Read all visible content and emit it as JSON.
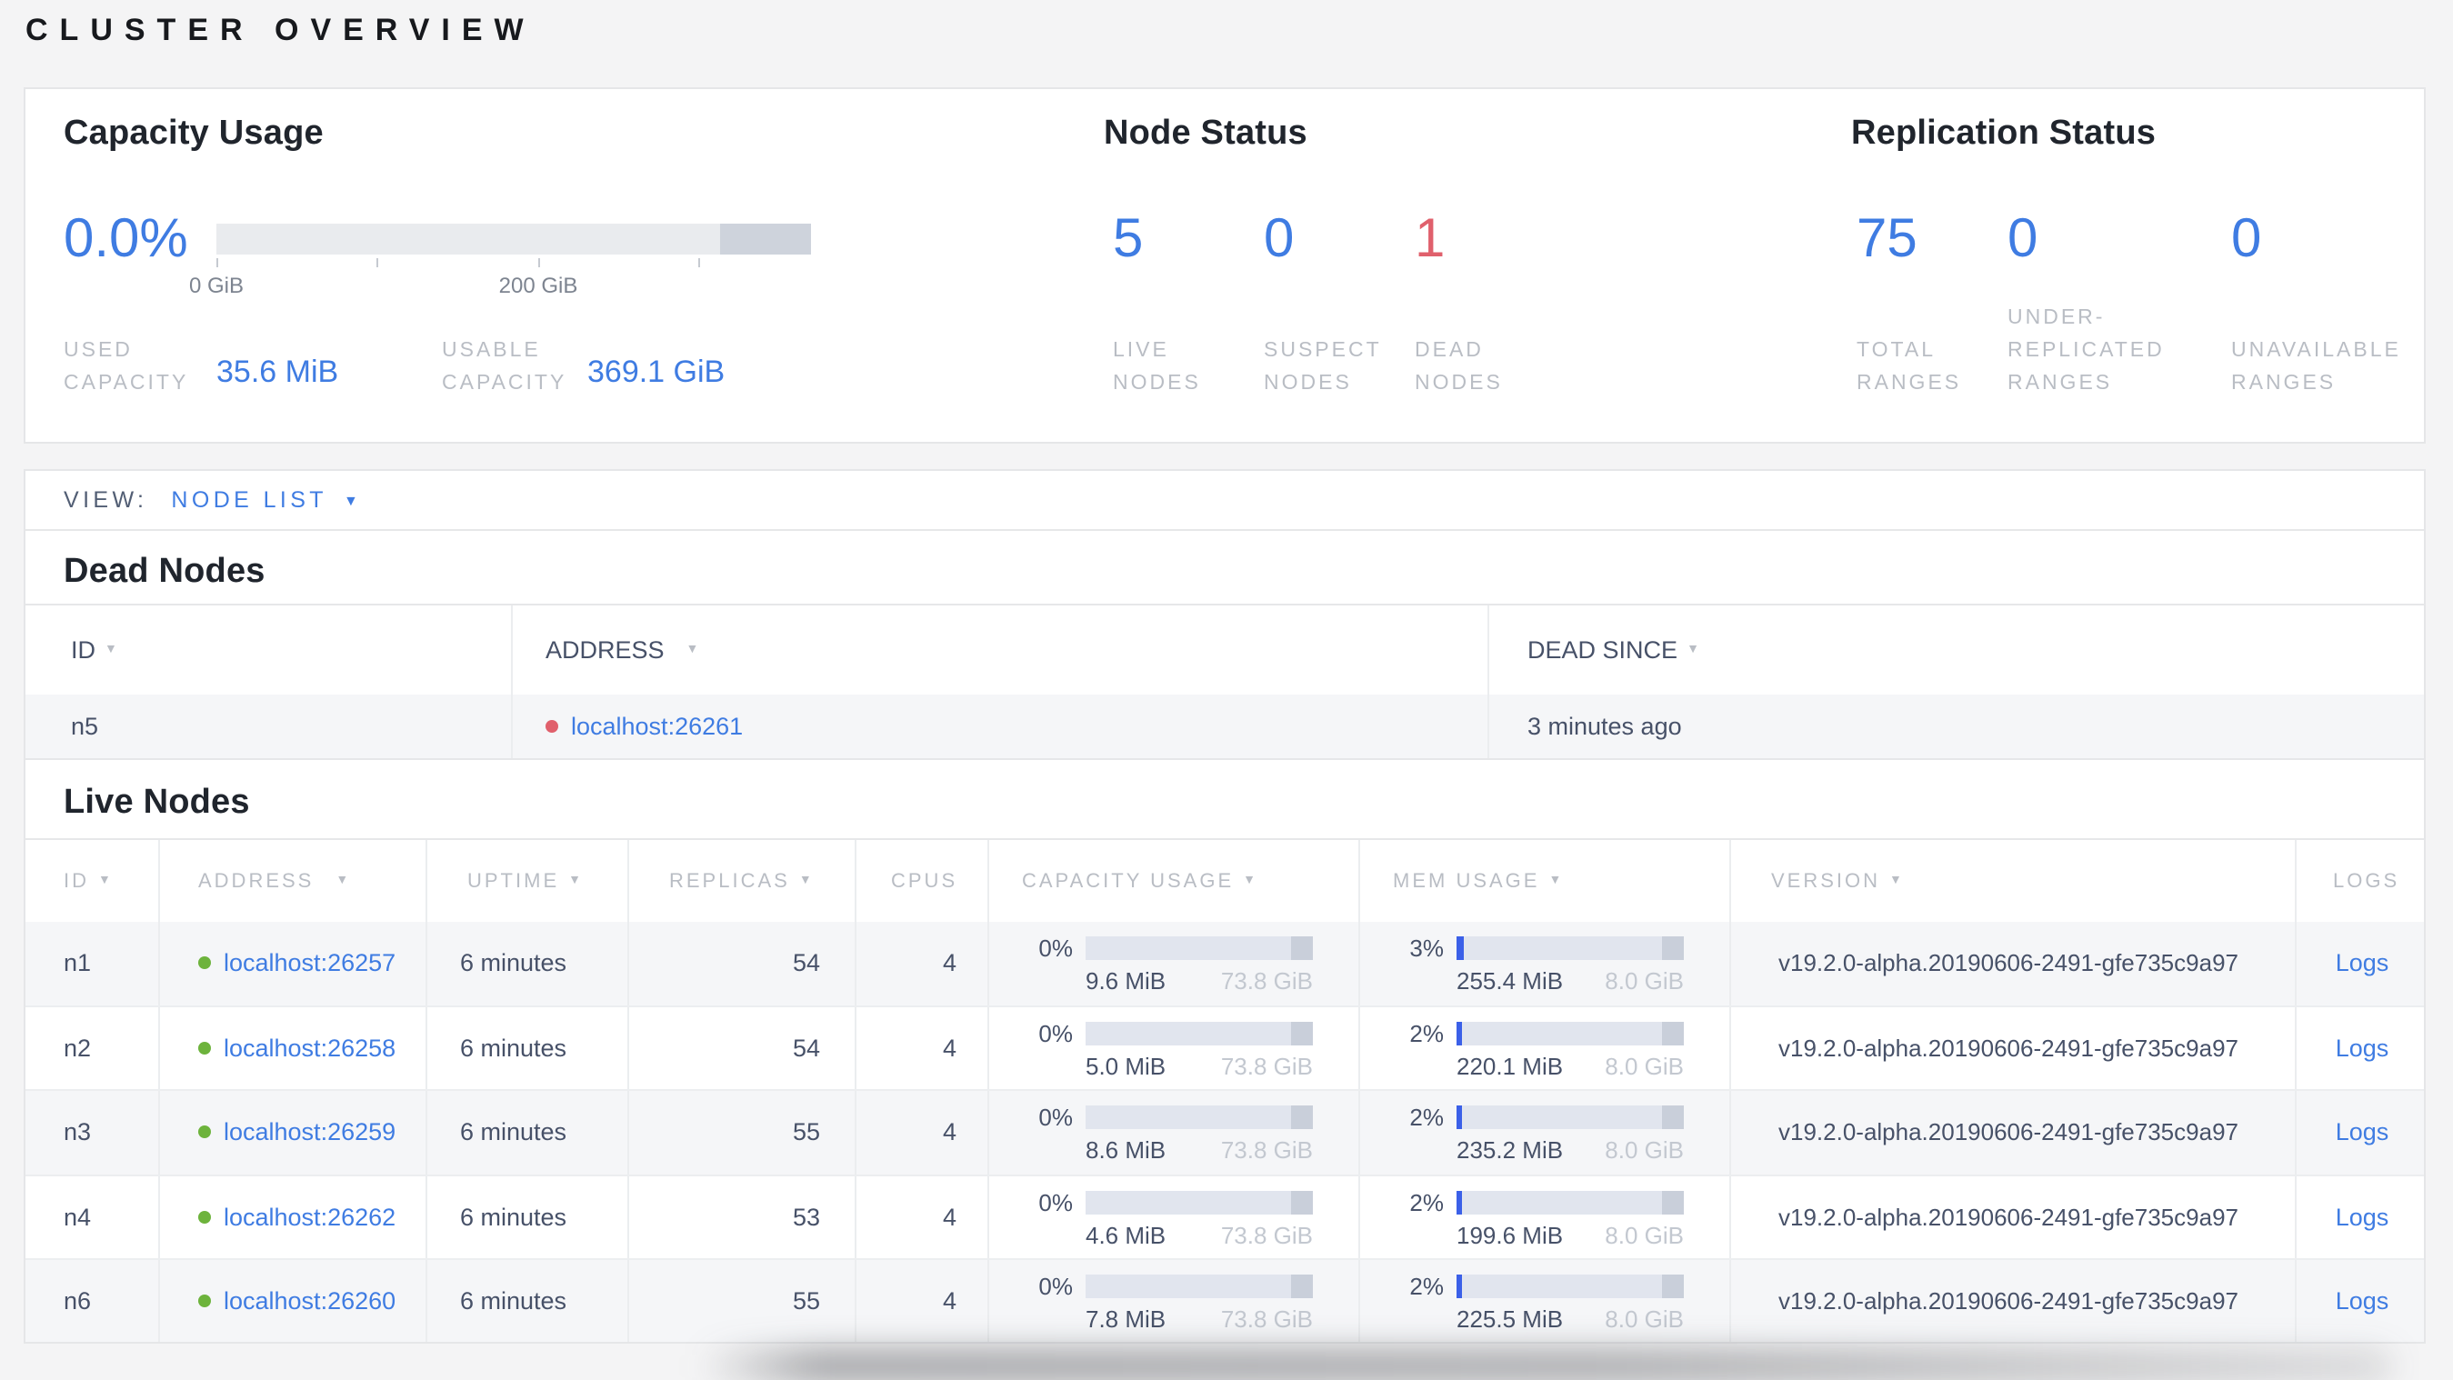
{
  "page": {
    "title": "CLUSTER OVERVIEW"
  },
  "icons": {
    "sort_caret": "▼",
    "dropdown_caret": "▼"
  },
  "colors": {
    "accent_blue": "#3f7ce2",
    "danger_red": "#e0606c",
    "live_green": "#6db33c",
    "mem_fill_blue": "#3b60e8",
    "slate_text": "#475168",
    "muted_label": "#b9bdc4"
  },
  "overview": {
    "capacity": {
      "heading": "Capacity Usage",
      "percent": "0.0%",
      "tick_labels": [
        "0 GiB",
        "200 GiB"
      ],
      "used_label": "USED CAPACITY",
      "used_value": "35.6 MiB",
      "usable_label": "USABLE CAPACITY",
      "usable_value": "369.1 GiB"
    },
    "node_status": {
      "heading": "Node Status",
      "stats": [
        {
          "value": "5",
          "label": "LIVE NODES"
        },
        {
          "value": "0",
          "label": "SUSPECT NODES"
        },
        {
          "value": "1",
          "label": "DEAD NODES"
        }
      ]
    },
    "replication": {
      "heading": "Replication Status",
      "stats": [
        {
          "value": "75",
          "label": "TOTAL RANGES"
        },
        {
          "value": "0",
          "label": "UNDER-REPLICATED RANGES"
        },
        {
          "value": "0",
          "label": "UNAVAILABLE RANGES"
        }
      ]
    }
  },
  "view_bar": {
    "label": "VIEW:",
    "selected": "NODE LIST"
  },
  "dead_nodes": {
    "heading": "Dead Nodes",
    "columns": [
      "ID",
      "ADDRESS",
      "DEAD SINCE"
    ],
    "rows": [
      {
        "id": "n5",
        "address": "localhost:26261",
        "dead_since": "3 minutes ago"
      }
    ]
  },
  "live_nodes": {
    "heading": "Live Nodes",
    "columns": [
      "ID",
      "ADDRESS",
      "UPTIME",
      "REPLICAS",
      "CPUS",
      "CAPACITY USAGE",
      "MEM USAGE",
      "VERSION",
      "LOGS"
    ],
    "rows": [
      {
        "id": "n1",
        "address": "localhost:26257",
        "uptime": "6 minutes",
        "replicas": "54",
        "cpus": "4",
        "capacity": {
          "pct": "0%",
          "used": "9.6 MiB",
          "total": "73.8 GiB",
          "fill": "0%"
        },
        "mem": {
          "pct": "3%",
          "used": "255.4 MiB",
          "total": "8.0 GiB",
          "fill": "3%"
        },
        "version": "v19.2.0-alpha.20190606-2491-gfe735c9a97",
        "logs": "Logs"
      },
      {
        "id": "n2",
        "address": "localhost:26258",
        "uptime": "6 minutes",
        "replicas": "54",
        "cpus": "4",
        "capacity": {
          "pct": "0%",
          "used": "5.0 MiB",
          "total": "73.8 GiB",
          "fill": "0%"
        },
        "mem": {
          "pct": "2%",
          "used": "220.1 MiB",
          "total": "8.0 GiB",
          "fill": "2%"
        },
        "version": "v19.2.0-alpha.20190606-2491-gfe735c9a97",
        "logs": "Logs"
      },
      {
        "id": "n3",
        "address": "localhost:26259",
        "uptime": "6 minutes",
        "replicas": "55",
        "cpus": "4",
        "capacity": {
          "pct": "0%",
          "used": "8.6 MiB",
          "total": "73.8 GiB",
          "fill": "0%"
        },
        "mem": {
          "pct": "2%",
          "used": "235.2 MiB",
          "total": "8.0 GiB",
          "fill": "2%"
        },
        "version": "v19.2.0-alpha.20190606-2491-gfe735c9a97",
        "logs": "Logs"
      },
      {
        "id": "n4",
        "address": "localhost:26262",
        "uptime": "6 minutes",
        "replicas": "53",
        "cpus": "4",
        "capacity": {
          "pct": "0%",
          "used": "4.6 MiB",
          "total": "73.8 GiB",
          "fill": "0%"
        },
        "mem": {
          "pct": "2%",
          "used": "199.6 MiB",
          "total": "8.0 GiB",
          "fill": "2%"
        },
        "version": "v19.2.0-alpha.20190606-2491-gfe735c9a97",
        "logs": "Logs"
      },
      {
        "id": "n6",
        "address": "localhost:26260",
        "uptime": "6 minutes",
        "replicas": "55",
        "cpus": "4",
        "capacity": {
          "pct": "0%",
          "used": "7.8 MiB",
          "total": "73.8 GiB",
          "fill": "0%"
        },
        "mem": {
          "pct": "2%",
          "used": "225.5 MiB",
          "total": "8.0 GiB",
          "fill": "2%"
        },
        "version": "v19.2.0-alpha.20190606-2491-gfe735c9a97",
        "logs": "Logs"
      }
    ]
  }
}
